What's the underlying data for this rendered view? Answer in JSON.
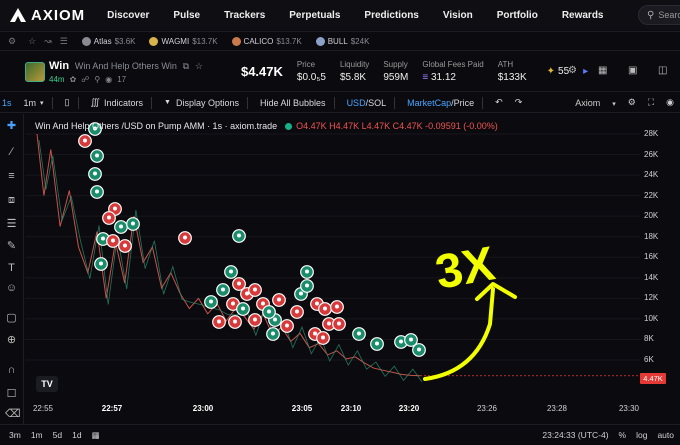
{
  "app": {
    "brand": "AXIOM"
  },
  "nav": {
    "links": [
      "Discover",
      "Pulse",
      "Trackers",
      "Perpetuals",
      "Predictions",
      "Vision",
      "Portfolio",
      "Rewards"
    ],
    "search_placeholder": "Search"
  },
  "watchlist": {
    "items": [
      {
        "name": "Atlas",
        "value": "$3.6K",
        "color": "#8a8a93"
      },
      {
        "name": "WAGMI",
        "value": "$13.7K",
        "color": "#d8b24a"
      },
      {
        "name": "CALICO",
        "value": "$13.7K",
        "color": "#c97a4a"
      },
      {
        "name": "BULL",
        "value": "$24K",
        "color": "#8ca0c8"
      }
    ]
  },
  "token": {
    "ticker": "Win",
    "full_name": "Win And Help Others Win",
    "age": "44m",
    "holders_count": "17",
    "price": "$4.47K",
    "stats": [
      {
        "label": "Price",
        "value": "$0.0₅5",
        "green": false
      },
      {
        "label": "Liquidity",
        "value": "$5.8K",
        "green": false
      },
      {
        "label": "Supply",
        "value": "959M",
        "green": false
      },
      {
        "label": "Global Fees Paid",
        "value": "31.12",
        "green": false
      },
      {
        "label": "ATH",
        "value": "$133K",
        "green": false
      }
    ],
    "score": "55"
  },
  "chart_toolbar": {
    "timeframe_active": "1s",
    "interval": "1m",
    "indicators": "Indicators",
    "display_options": "Display Options",
    "hide_bubbles": "Hide All Bubbles",
    "currency_usd": "USD",
    "currency_sep": "/",
    "currency_sol": "SOL",
    "mode_mcap": "MarketCap",
    "mode_price": "/Price",
    "source": "Axiom"
  },
  "legend": {
    "title": "Win And Help Others /USD on Pump AMM · 1s · axiom.trade",
    "ohlc": "O4.47K H4.47K L4.47K C4.47K -0.09591 (-0.00%)"
  },
  "chart_data": {
    "type": "line",
    "title": "Win And Help Others /USD on Pump AMM · 1s · axiom.trade",
    "y_ticks": [
      "28K",
      "26K",
      "24K",
      "22K",
      "20K",
      "18K",
      "16K",
      "14K",
      "12K",
      "10K",
      "8K",
      "6K"
    ],
    "ylim": [
      4000,
      29000
    ],
    "x_ticks": [
      "22:55",
      "22:57",
      "23:00",
      "23:05",
      "23:10",
      "23:20",
      "23:26",
      "23:28",
      "23:30"
    ],
    "last_value_label": "4.47K",
    "series": [
      {
        "values": [
          [
            0,
            28000
          ],
          [
            3,
            22000
          ],
          [
            6,
            26500
          ],
          [
            10,
            19000
          ],
          [
            14,
            22500
          ],
          [
            18,
            17000
          ],
          [
            22,
            14500
          ],
          [
            26,
            18500
          ],
          [
            30,
            12000
          ],
          [
            34,
            17500
          ],
          [
            38,
            13500
          ],
          [
            42,
            20000
          ],
          [
            46,
            15500
          ],
          [
            50,
            17000
          ],
          [
            54,
            13000
          ],
          [
            58,
            14500
          ],
          [
            62,
            12500
          ],
          [
            66,
            11000
          ],
          [
            70,
            12000
          ],
          [
            74,
            10500
          ],
          [
            78,
            11500
          ],
          [
            82,
            9800
          ],
          [
            86,
            11000
          ],
          [
            90,
            10200
          ],
          [
            94,
            9000
          ],
          [
            98,
            10500
          ],
          [
            102,
            8500
          ],
          [
            106,
            9200
          ],
          [
            110,
            7800
          ],
          [
            114,
            8600
          ],
          [
            118,
            7200
          ],
          [
            122,
            7600
          ],
          [
            126,
            6500
          ],
          [
            130,
            6900
          ],
          [
            134,
            6100
          ],
          [
            138,
            6300
          ],
          [
            142,
            5700
          ],
          [
            146,
            5200
          ],
          [
            150,
            5000
          ],
          [
            154,
            4800
          ],
          [
            158,
            4600
          ],
          [
            162,
            4500
          ],
          [
            166,
            4470
          ]
        ]
      }
    ]
  },
  "annotation": {
    "text": "3X"
  },
  "bottom": {
    "timeframes": [
      "3m",
      "1m",
      "5d",
      "1d"
    ],
    "clock": "23:24:33 (UTC-4)",
    "pct": "%",
    "log": "log",
    "auto": "auto"
  }
}
